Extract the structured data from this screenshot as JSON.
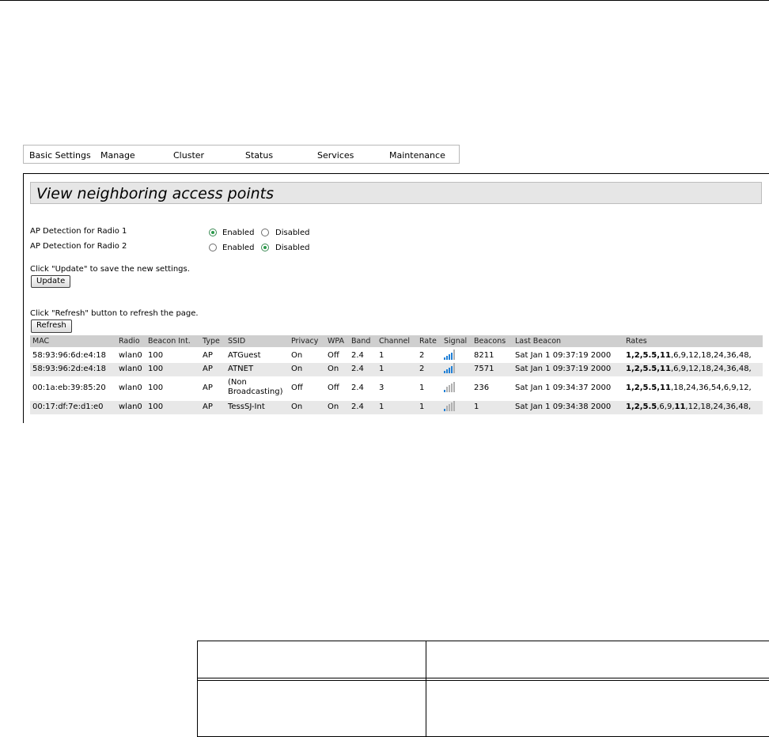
{
  "nav": [
    "Basic Settings",
    "Manage",
    "Cluster",
    "Status",
    "Services",
    "Maintenance"
  ],
  "title": "View neighboring access points",
  "detection": {
    "radio1_label": "AP Detection for Radio 1",
    "radio2_label": "AP Detection for Radio 2",
    "enabled": "Enabled",
    "disabled": "Disabled",
    "radio1_value": "Enabled",
    "radio2_value": "Disabled"
  },
  "update_hint": "Click \"Update\" to save the new settings.",
  "update_button": "Update",
  "refresh_hint": "Click \"Refresh\" button to refresh the page.",
  "refresh_button": "Refresh",
  "table": {
    "headers": [
      "MAC",
      "Radio",
      "Beacon Int.",
      "Type",
      "SSID",
      "Privacy",
      "WPA",
      "Band",
      "Channel",
      "Rate",
      "Signal",
      "Beacons",
      "Last Beacon",
      "Rates"
    ],
    "rows": [
      {
        "mac": "58:93:96:6d:e4:18",
        "radio": "wlan0",
        "beacon_int": "100",
        "type": "AP",
        "ssid": "ATGuest",
        "privacy": "On",
        "wpa": "Off",
        "band": "2.4",
        "channel": "1",
        "rate": "2",
        "signal_bars": 4,
        "beacons": "8211",
        "last_beacon": "Sat Jan 1 09:37:19 2000",
        "rates_bold": "1,2,5.5,11",
        "rates_rest": ",6,9,12,18,24,36,48,"
      },
      {
        "mac": "58:93:96:2d:e4:18",
        "radio": "wlan0",
        "beacon_int": "100",
        "type": "AP",
        "ssid": "ATNET",
        "privacy": "On",
        "wpa": "On",
        "band": "2.4",
        "channel": "1",
        "rate": "2",
        "signal_bars": 4,
        "beacons": "7571",
        "last_beacon": "Sat Jan 1 09:37:19 2000",
        "rates_bold": "1,2,5.5,11",
        "rates_rest": ",6,9,12,18,24,36,48,"
      },
      {
        "mac": "00:1a:eb:39:85:20",
        "radio": "wlan0",
        "beacon_int": "100",
        "type": "AP",
        "ssid": "(Non Broadcasting)",
        "privacy": "Off",
        "wpa": "Off",
        "band": "2.4",
        "channel": "3",
        "rate": "1",
        "signal_bars": 1,
        "beacons": "236",
        "last_beacon": "Sat Jan 1 09:34:37 2000",
        "rates_bold": "1,2,5.5,11",
        "rates_rest": ",18,24,36,54,6,9,12,"
      },
      {
        "mac": "00:17:df:7e:d1:e0",
        "radio": "wlan0",
        "beacon_int": "100",
        "type": "AP",
        "ssid": "TessSJ-Int",
        "privacy": "On",
        "wpa": "On",
        "band": "2.4",
        "channel": "1",
        "rate": "1",
        "signal_bars": 1,
        "beacons": "1",
        "last_beacon": "Sat Jan 1 09:34:38 2000",
        "rates_bold": "1,2,5.5",
        "rates_mid": ",6,9,",
        "rates_bold2": "11",
        "rates_rest": ",12,18,24,36,48,"
      }
    ]
  },
  "colors": {
    "signal_active": "#1f7fd6",
    "signal_inactive": "#b0b0b0",
    "radio_selected": "#2a9a4a"
  }
}
